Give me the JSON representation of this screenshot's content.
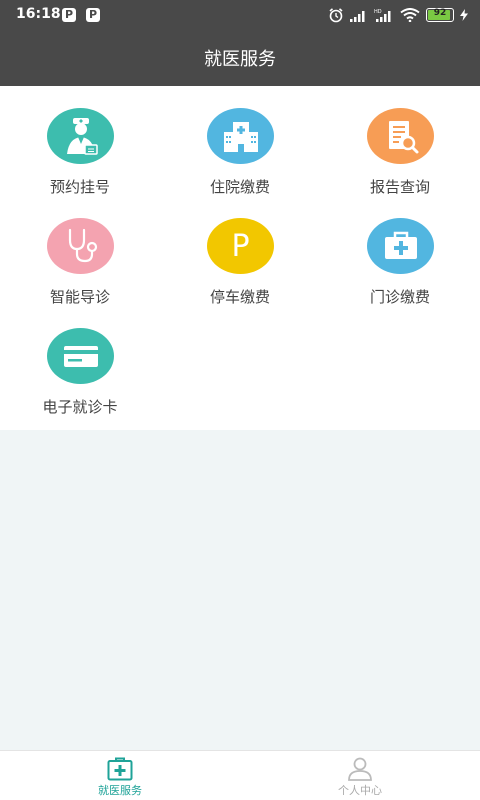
{
  "status_bar": {
    "time": "16:18",
    "notification_icons": [
      "P",
      "P"
    ],
    "battery": "92",
    "battery_fraction": 0.92,
    "icons": [
      "alarm-icon",
      "signal-icon",
      "hd-signal-icon",
      "wifi-icon",
      "battery-icon",
      "charging-icon"
    ]
  },
  "header": {
    "title": "就医服务"
  },
  "services": [
    {
      "label": "预约挂号",
      "icon": "doctor-icon",
      "color": "#3dbdae"
    },
    {
      "label": "住院缴费",
      "icon": "hospital-icon",
      "color": "#52b6e0"
    },
    {
      "label": "报告查询",
      "icon": "report-search-icon",
      "color": "#f79d55"
    },
    {
      "label": "智能导诊",
      "icon": "stethoscope-icon",
      "color": "#f4a3b0"
    },
    {
      "label": "停车缴费",
      "icon": "parking-icon",
      "parking_letter": "P",
      "color": "#f2c700"
    },
    {
      "label": "门诊缴费",
      "icon": "medical-kit-icon",
      "color": "#52b6e0"
    },
    {
      "label": "电子就诊卡",
      "icon": "card-icon",
      "color": "#3dbdae"
    }
  ],
  "tab_bar": {
    "tabs": [
      {
        "label": "就医服务",
        "icon": "medical-service-icon",
        "active": true
      },
      {
        "label": "个人中心",
        "icon": "person-icon",
        "active": false
      }
    ],
    "active_color": "#1fa398",
    "inactive_color": "#aaaaaa"
  }
}
